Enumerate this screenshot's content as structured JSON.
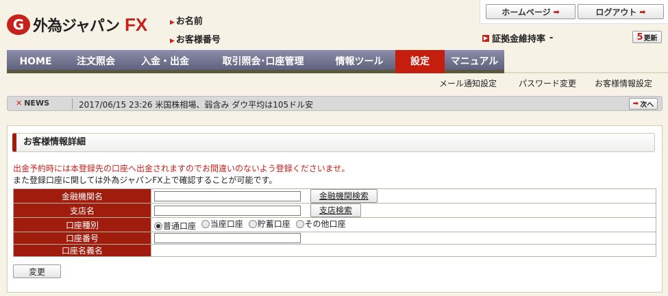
{
  "brand": {
    "mark": "G",
    "name": "外為ジャパン",
    "fx": "FX",
    "color": "#c8201a"
  },
  "account": {
    "name_label": "お名前",
    "number_label": "お客様番号"
  },
  "top_buttons": {
    "home": "ホームページ",
    "logout": "ログアウト"
  },
  "margin_rate": {
    "label": "証拠金維持率",
    "value": "-"
  },
  "refresh": {
    "num": "5",
    "label": "更新"
  },
  "nav": {
    "items": [
      "HOME",
      "注文照会",
      "入金・出金",
      "取引照会･口座管理",
      "情報ツール",
      "設定",
      "マニュアル"
    ],
    "active": "設定"
  },
  "subnav": [
    "メール通知設定",
    "パスワード変更",
    "お客様情報設定"
  ],
  "news": {
    "label": "NEWS",
    "text": "2017/06/15 23:26  米国株相場、弱含み  ダウ平均は105ドル安",
    "next": "次へ"
  },
  "section_title": "お客様情報詳細",
  "messages": {
    "warning": "出金予約時には本登録先の口座へ出金されますのでお間違いのないよう登録くださいませ。",
    "note": "また登録口座に関しては外為ジャパンFX上で確認することが可能です。"
  },
  "form": {
    "bank_label": "金融機関名",
    "bank_search": "金融機関検索",
    "branch_label": "支店名",
    "branch_search": "支店検索",
    "type_label": "口座種別",
    "types": [
      "普通口座",
      "当座口座",
      "貯蓄口座",
      "その他口座"
    ],
    "selected_type": "普通口座",
    "number_label": "口座番号",
    "holder_label": "口座名義名",
    "submit": "変更"
  }
}
